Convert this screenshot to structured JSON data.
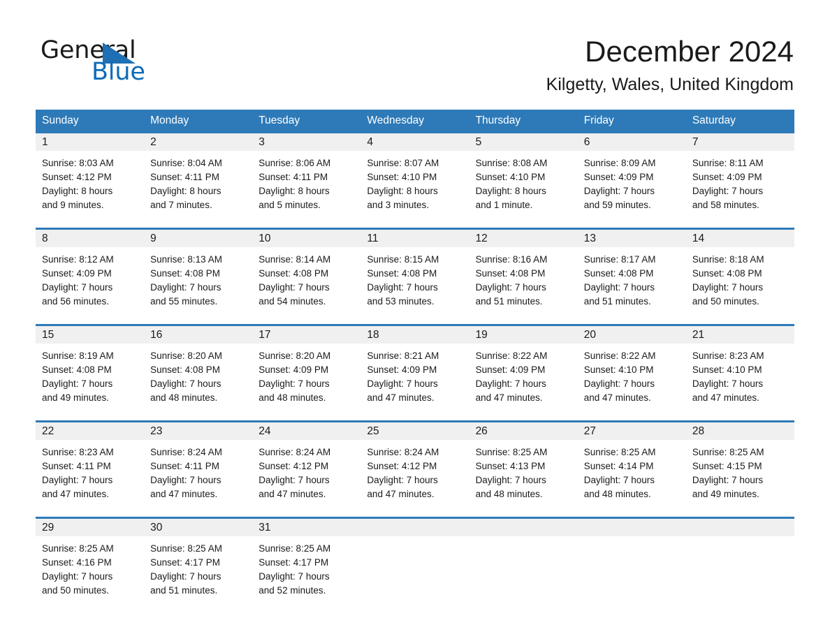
{
  "brand": {
    "name_part1": "General",
    "name_part2": "Blue",
    "triangle_color": "#1f6fb4",
    "blue_color": "#0d6cb9"
  },
  "header": {
    "title": "December 2024",
    "location": "Kilgetty, Wales, United Kingdom"
  },
  "theme": {
    "header_blue": "#2e7ab8",
    "row_rule_blue": "#2e7ab8",
    "day_band_gray": "#f0f0f0",
    "text_color": "#1a1a1a"
  },
  "weekdays": [
    "Sunday",
    "Monday",
    "Tuesday",
    "Wednesday",
    "Thursday",
    "Friday",
    "Saturday"
  ],
  "labels": {
    "sunrise_prefix": "Sunrise:",
    "sunset_prefix": "Sunset:",
    "daylight_prefix": "Daylight:"
  },
  "weeks": [
    {
      "days": [
        {
          "num": "1",
          "sunrise": "Sunrise: 8:03 AM",
          "sunset": "Sunset: 4:12 PM",
          "daylight_l1": "Daylight: 8 hours",
          "daylight_l2": "and 9 minutes."
        },
        {
          "num": "2",
          "sunrise": "Sunrise: 8:04 AM",
          "sunset": "Sunset: 4:11 PM",
          "daylight_l1": "Daylight: 8 hours",
          "daylight_l2": "and 7 minutes."
        },
        {
          "num": "3",
          "sunrise": "Sunrise: 8:06 AM",
          "sunset": "Sunset: 4:11 PM",
          "daylight_l1": "Daylight: 8 hours",
          "daylight_l2": "and 5 minutes."
        },
        {
          "num": "4",
          "sunrise": "Sunrise: 8:07 AM",
          "sunset": "Sunset: 4:10 PM",
          "daylight_l1": "Daylight: 8 hours",
          "daylight_l2": "and 3 minutes."
        },
        {
          "num": "5",
          "sunrise": "Sunrise: 8:08 AM",
          "sunset": "Sunset: 4:10 PM",
          "daylight_l1": "Daylight: 8 hours",
          "daylight_l2": "and 1 minute."
        },
        {
          "num": "6",
          "sunrise": "Sunrise: 8:09 AM",
          "sunset": "Sunset: 4:09 PM",
          "daylight_l1": "Daylight: 7 hours",
          "daylight_l2": "and 59 minutes."
        },
        {
          "num": "7",
          "sunrise": "Sunrise: 8:11 AM",
          "sunset": "Sunset: 4:09 PM",
          "daylight_l1": "Daylight: 7 hours",
          "daylight_l2": "and 58 minutes."
        }
      ]
    },
    {
      "days": [
        {
          "num": "8",
          "sunrise": "Sunrise: 8:12 AM",
          "sunset": "Sunset: 4:09 PM",
          "daylight_l1": "Daylight: 7 hours",
          "daylight_l2": "and 56 minutes."
        },
        {
          "num": "9",
          "sunrise": "Sunrise: 8:13 AM",
          "sunset": "Sunset: 4:08 PM",
          "daylight_l1": "Daylight: 7 hours",
          "daylight_l2": "and 55 minutes."
        },
        {
          "num": "10",
          "sunrise": "Sunrise: 8:14 AM",
          "sunset": "Sunset: 4:08 PM",
          "daylight_l1": "Daylight: 7 hours",
          "daylight_l2": "and 54 minutes."
        },
        {
          "num": "11",
          "sunrise": "Sunrise: 8:15 AM",
          "sunset": "Sunset: 4:08 PM",
          "daylight_l1": "Daylight: 7 hours",
          "daylight_l2": "and 53 minutes."
        },
        {
          "num": "12",
          "sunrise": "Sunrise: 8:16 AM",
          "sunset": "Sunset: 4:08 PM",
          "daylight_l1": "Daylight: 7 hours",
          "daylight_l2": "and 51 minutes."
        },
        {
          "num": "13",
          "sunrise": "Sunrise: 8:17 AM",
          "sunset": "Sunset: 4:08 PM",
          "daylight_l1": "Daylight: 7 hours",
          "daylight_l2": "and 51 minutes."
        },
        {
          "num": "14",
          "sunrise": "Sunrise: 8:18 AM",
          "sunset": "Sunset: 4:08 PM",
          "daylight_l1": "Daylight: 7 hours",
          "daylight_l2": "and 50 minutes."
        }
      ]
    },
    {
      "days": [
        {
          "num": "15",
          "sunrise": "Sunrise: 8:19 AM",
          "sunset": "Sunset: 4:08 PM",
          "daylight_l1": "Daylight: 7 hours",
          "daylight_l2": "and 49 minutes."
        },
        {
          "num": "16",
          "sunrise": "Sunrise: 8:20 AM",
          "sunset": "Sunset: 4:08 PM",
          "daylight_l1": "Daylight: 7 hours",
          "daylight_l2": "and 48 minutes."
        },
        {
          "num": "17",
          "sunrise": "Sunrise: 8:20 AM",
          "sunset": "Sunset: 4:09 PM",
          "daylight_l1": "Daylight: 7 hours",
          "daylight_l2": "and 48 minutes."
        },
        {
          "num": "18",
          "sunrise": "Sunrise: 8:21 AM",
          "sunset": "Sunset: 4:09 PM",
          "daylight_l1": "Daylight: 7 hours",
          "daylight_l2": "and 47 minutes."
        },
        {
          "num": "19",
          "sunrise": "Sunrise: 8:22 AM",
          "sunset": "Sunset: 4:09 PM",
          "daylight_l1": "Daylight: 7 hours",
          "daylight_l2": "and 47 minutes."
        },
        {
          "num": "20",
          "sunrise": "Sunrise: 8:22 AM",
          "sunset": "Sunset: 4:10 PM",
          "daylight_l1": "Daylight: 7 hours",
          "daylight_l2": "and 47 minutes."
        },
        {
          "num": "21",
          "sunrise": "Sunrise: 8:23 AM",
          "sunset": "Sunset: 4:10 PM",
          "daylight_l1": "Daylight: 7 hours",
          "daylight_l2": "and 47 minutes."
        }
      ]
    },
    {
      "days": [
        {
          "num": "22",
          "sunrise": "Sunrise: 8:23 AM",
          "sunset": "Sunset: 4:11 PM",
          "daylight_l1": "Daylight: 7 hours",
          "daylight_l2": "and 47 minutes."
        },
        {
          "num": "23",
          "sunrise": "Sunrise: 8:24 AM",
          "sunset": "Sunset: 4:11 PM",
          "daylight_l1": "Daylight: 7 hours",
          "daylight_l2": "and 47 minutes."
        },
        {
          "num": "24",
          "sunrise": "Sunrise: 8:24 AM",
          "sunset": "Sunset: 4:12 PM",
          "daylight_l1": "Daylight: 7 hours",
          "daylight_l2": "and 47 minutes."
        },
        {
          "num": "25",
          "sunrise": "Sunrise: 8:24 AM",
          "sunset": "Sunset: 4:12 PM",
          "daylight_l1": "Daylight: 7 hours",
          "daylight_l2": "and 47 minutes."
        },
        {
          "num": "26",
          "sunrise": "Sunrise: 8:25 AM",
          "sunset": "Sunset: 4:13 PM",
          "daylight_l1": "Daylight: 7 hours",
          "daylight_l2": "and 48 minutes."
        },
        {
          "num": "27",
          "sunrise": "Sunrise: 8:25 AM",
          "sunset": "Sunset: 4:14 PM",
          "daylight_l1": "Daylight: 7 hours",
          "daylight_l2": "and 48 minutes."
        },
        {
          "num": "28",
          "sunrise": "Sunrise: 8:25 AM",
          "sunset": "Sunset: 4:15 PM",
          "daylight_l1": "Daylight: 7 hours",
          "daylight_l2": "and 49 minutes."
        }
      ]
    },
    {
      "days": [
        {
          "num": "29",
          "sunrise": "Sunrise: 8:25 AM",
          "sunset": "Sunset: 4:16 PM",
          "daylight_l1": "Daylight: 7 hours",
          "daylight_l2": "and 50 minutes."
        },
        {
          "num": "30",
          "sunrise": "Sunrise: 8:25 AM",
          "sunset": "Sunset: 4:17 PM",
          "daylight_l1": "Daylight: 7 hours",
          "daylight_l2": "and 51 minutes."
        },
        {
          "num": "31",
          "sunrise": "Sunrise: 8:25 AM",
          "sunset": "Sunset: 4:17 PM",
          "daylight_l1": "Daylight: 7 hours",
          "daylight_l2": "and 52 minutes."
        },
        {
          "num": "",
          "sunrise": "",
          "sunset": "",
          "daylight_l1": "",
          "daylight_l2": ""
        },
        {
          "num": "",
          "sunrise": "",
          "sunset": "",
          "daylight_l1": "",
          "daylight_l2": ""
        },
        {
          "num": "",
          "sunrise": "",
          "sunset": "",
          "daylight_l1": "",
          "daylight_l2": ""
        },
        {
          "num": "",
          "sunrise": "",
          "sunset": "",
          "daylight_l1": "",
          "daylight_l2": ""
        }
      ]
    }
  ]
}
